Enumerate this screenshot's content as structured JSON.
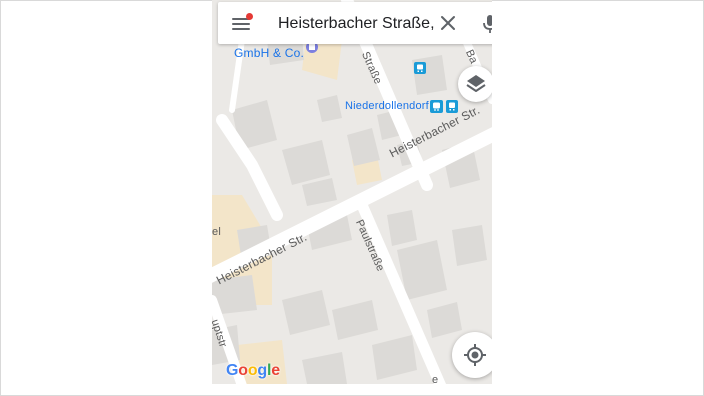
{
  "search": {
    "query": "Heisterbacher Straße,..."
  },
  "map": {
    "streets": {
      "heisterbacher_upper": "Heisterbacher Str.",
      "heisterbacher_lower": "Heisterbacher Str.",
      "paulstrasse": "Paulstraße",
      "strasse_top": "Straße",
      "hauptstrasse_partial": "uptstr",
      "el_partial": "el",
      "ba_partial": "Ba",
      "bottom_partial": "e"
    },
    "pois": {
      "gmbh": "GmbH & Co.",
      "station": "Niederdollendorf"
    },
    "logo": {
      "letters": [
        "G",
        "o",
        "o",
        "g",
        "l",
        "e"
      ],
      "colors": [
        "#4285F4",
        "#EA4335",
        "#FBBC05",
        "#4285F4",
        "#34A853",
        "#EA4335"
      ]
    }
  },
  "colors": {
    "poi_blue": "#1a73e8",
    "notification_red": "#e53935",
    "map_background": "#ebe9e6",
    "building": "#dcdad7",
    "commercial": "#f3e5c9"
  },
  "icons": {
    "menu": "menu-icon",
    "clear": "close-icon",
    "mic": "mic-icon",
    "layers": "layers-icon",
    "locate": "my-location-icon",
    "transit": "bus-icon"
  }
}
